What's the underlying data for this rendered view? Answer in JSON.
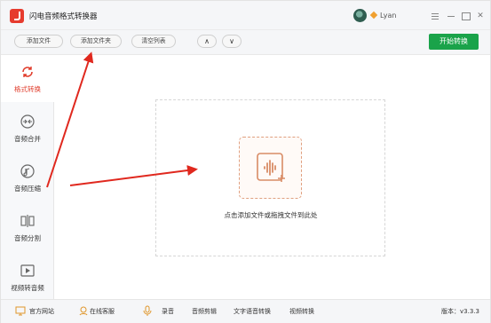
{
  "window": {
    "title": "闪电音频格式转换器",
    "username": "Lyan",
    "accent_color": "#1aa34a",
    "active_color": "#e03b2a"
  },
  "toolbar": {
    "add_file": "添加文件",
    "add_folder": "添加文件夹",
    "clear_list": "清空列表",
    "move_up": "∧",
    "move_down": "∨",
    "start_convert": "开始转换"
  },
  "sidebar": {
    "items": [
      {
        "label": "格式转换",
        "icon": "refresh-icon",
        "active": true
      },
      {
        "label": "音频合并",
        "icon": "merge-icon",
        "active": false
      },
      {
        "label": "音频压缩",
        "icon": "compress-icon",
        "active": false
      },
      {
        "label": "音频分割",
        "icon": "split-icon",
        "active": false
      },
      {
        "label": "视频转音频",
        "icon": "video-icon",
        "active": false
      }
    ]
  },
  "main": {
    "drop_hint": "点击添加文件或拖拽文件到此处"
  },
  "footer": {
    "official_site": "官方网站",
    "online_service": "在线客服",
    "record": "录音",
    "audio_cut": "音频剪辑",
    "text_to_speech": "文字语音转换",
    "video_convert": "视频转换",
    "version": "版本：v3.3.3"
  }
}
